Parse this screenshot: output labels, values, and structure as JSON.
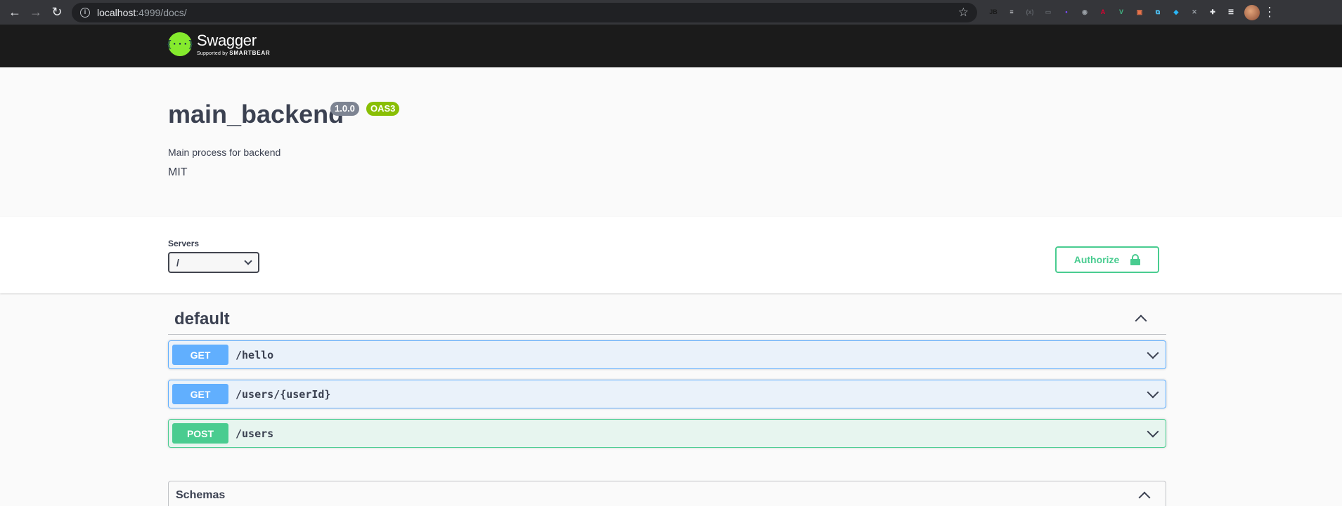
{
  "browser": {
    "url_host": "localhost",
    "url_rest": ":4999/docs/",
    "extensions": [
      {
        "name": "jetbrains-ext-icon",
        "glyph": "JB",
        "color": "#1a1a1a"
      },
      {
        "name": "notes-ext-icon",
        "glyph": "≡",
        "color": "#e8eaed"
      },
      {
        "name": "redux-ext-icon",
        "glyph": "(x)",
        "color": "#5f6368"
      },
      {
        "name": "pages-ext-icon",
        "glyph": "▭",
        "color": "#5f6368"
      },
      {
        "name": "purple-ext-icon",
        "glyph": "•",
        "color": "#7c4dff"
      },
      {
        "name": "camera-ext-icon",
        "glyph": "◉",
        "color": "#9aa0a6"
      },
      {
        "name": "angular-ext-icon",
        "glyph": "A",
        "color": "#dd0031"
      },
      {
        "name": "vue-ext-icon",
        "glyph": "V",
        "color": "#41b883"
      },
      {
        "name": "window-ext-icon",
        "glyph": "▣",
        "color": "#e8734a"
      },
      {
        "name": "screenshot-ext-icon",
        "glyph": "⧉",
        "color": "#4fc3f7"
      },
      {
        "name": "gem-ext-icon",
        "glyph": "◆",
        "color": "#29b6f6"
      },
      {
        "name": "tools-ext-icon",
        "glyph": "✕",
        "color": "#9aa0a6"
      },
      {
        "name": "puzzle-ext-icon",
        "glyph": "✚",
        "color": "#e8eaed"
      },
      {
        "name": "playlist-ext-icon",
        "glyph": "☰",
        "color": "#e8eaed"
      }
    ]
  },
  "logo": {
    "name": "Swagger",
    "supported_by": "Supported by",
    "brand": "SMARTBEAR"
  },
  "info": {
    "title": "main_backend",
    "version": "1.0.0",
    "oas": "OAS3",
    "description": "Main process for backend",
    "license": "MIT"
  },
  "servers": {
    "label": "Servers",
    "selected": "/"
  },
  "authorize": {
    "label": "Authorize"
  },
  "tag": {
    "name": "default"
  },
  "operations": [
    {
      "method": "GET",
      "path": "/hello"
    },
    {
      "method": "GET",
      "path": "/users/{userId}"
    },
    {
      "method": "POST",
      "path": "/users"
    }
  ],
  "schemas": {
    "title": "Schemas"
  },
  "colors": {
    "get": "#61affe",
    "post": "#49cc90",
    "swagger_green": "#85ea2d",
    "version_badge": "#7d8492",
    "oas_badge": "#89bf04"
  }
}
